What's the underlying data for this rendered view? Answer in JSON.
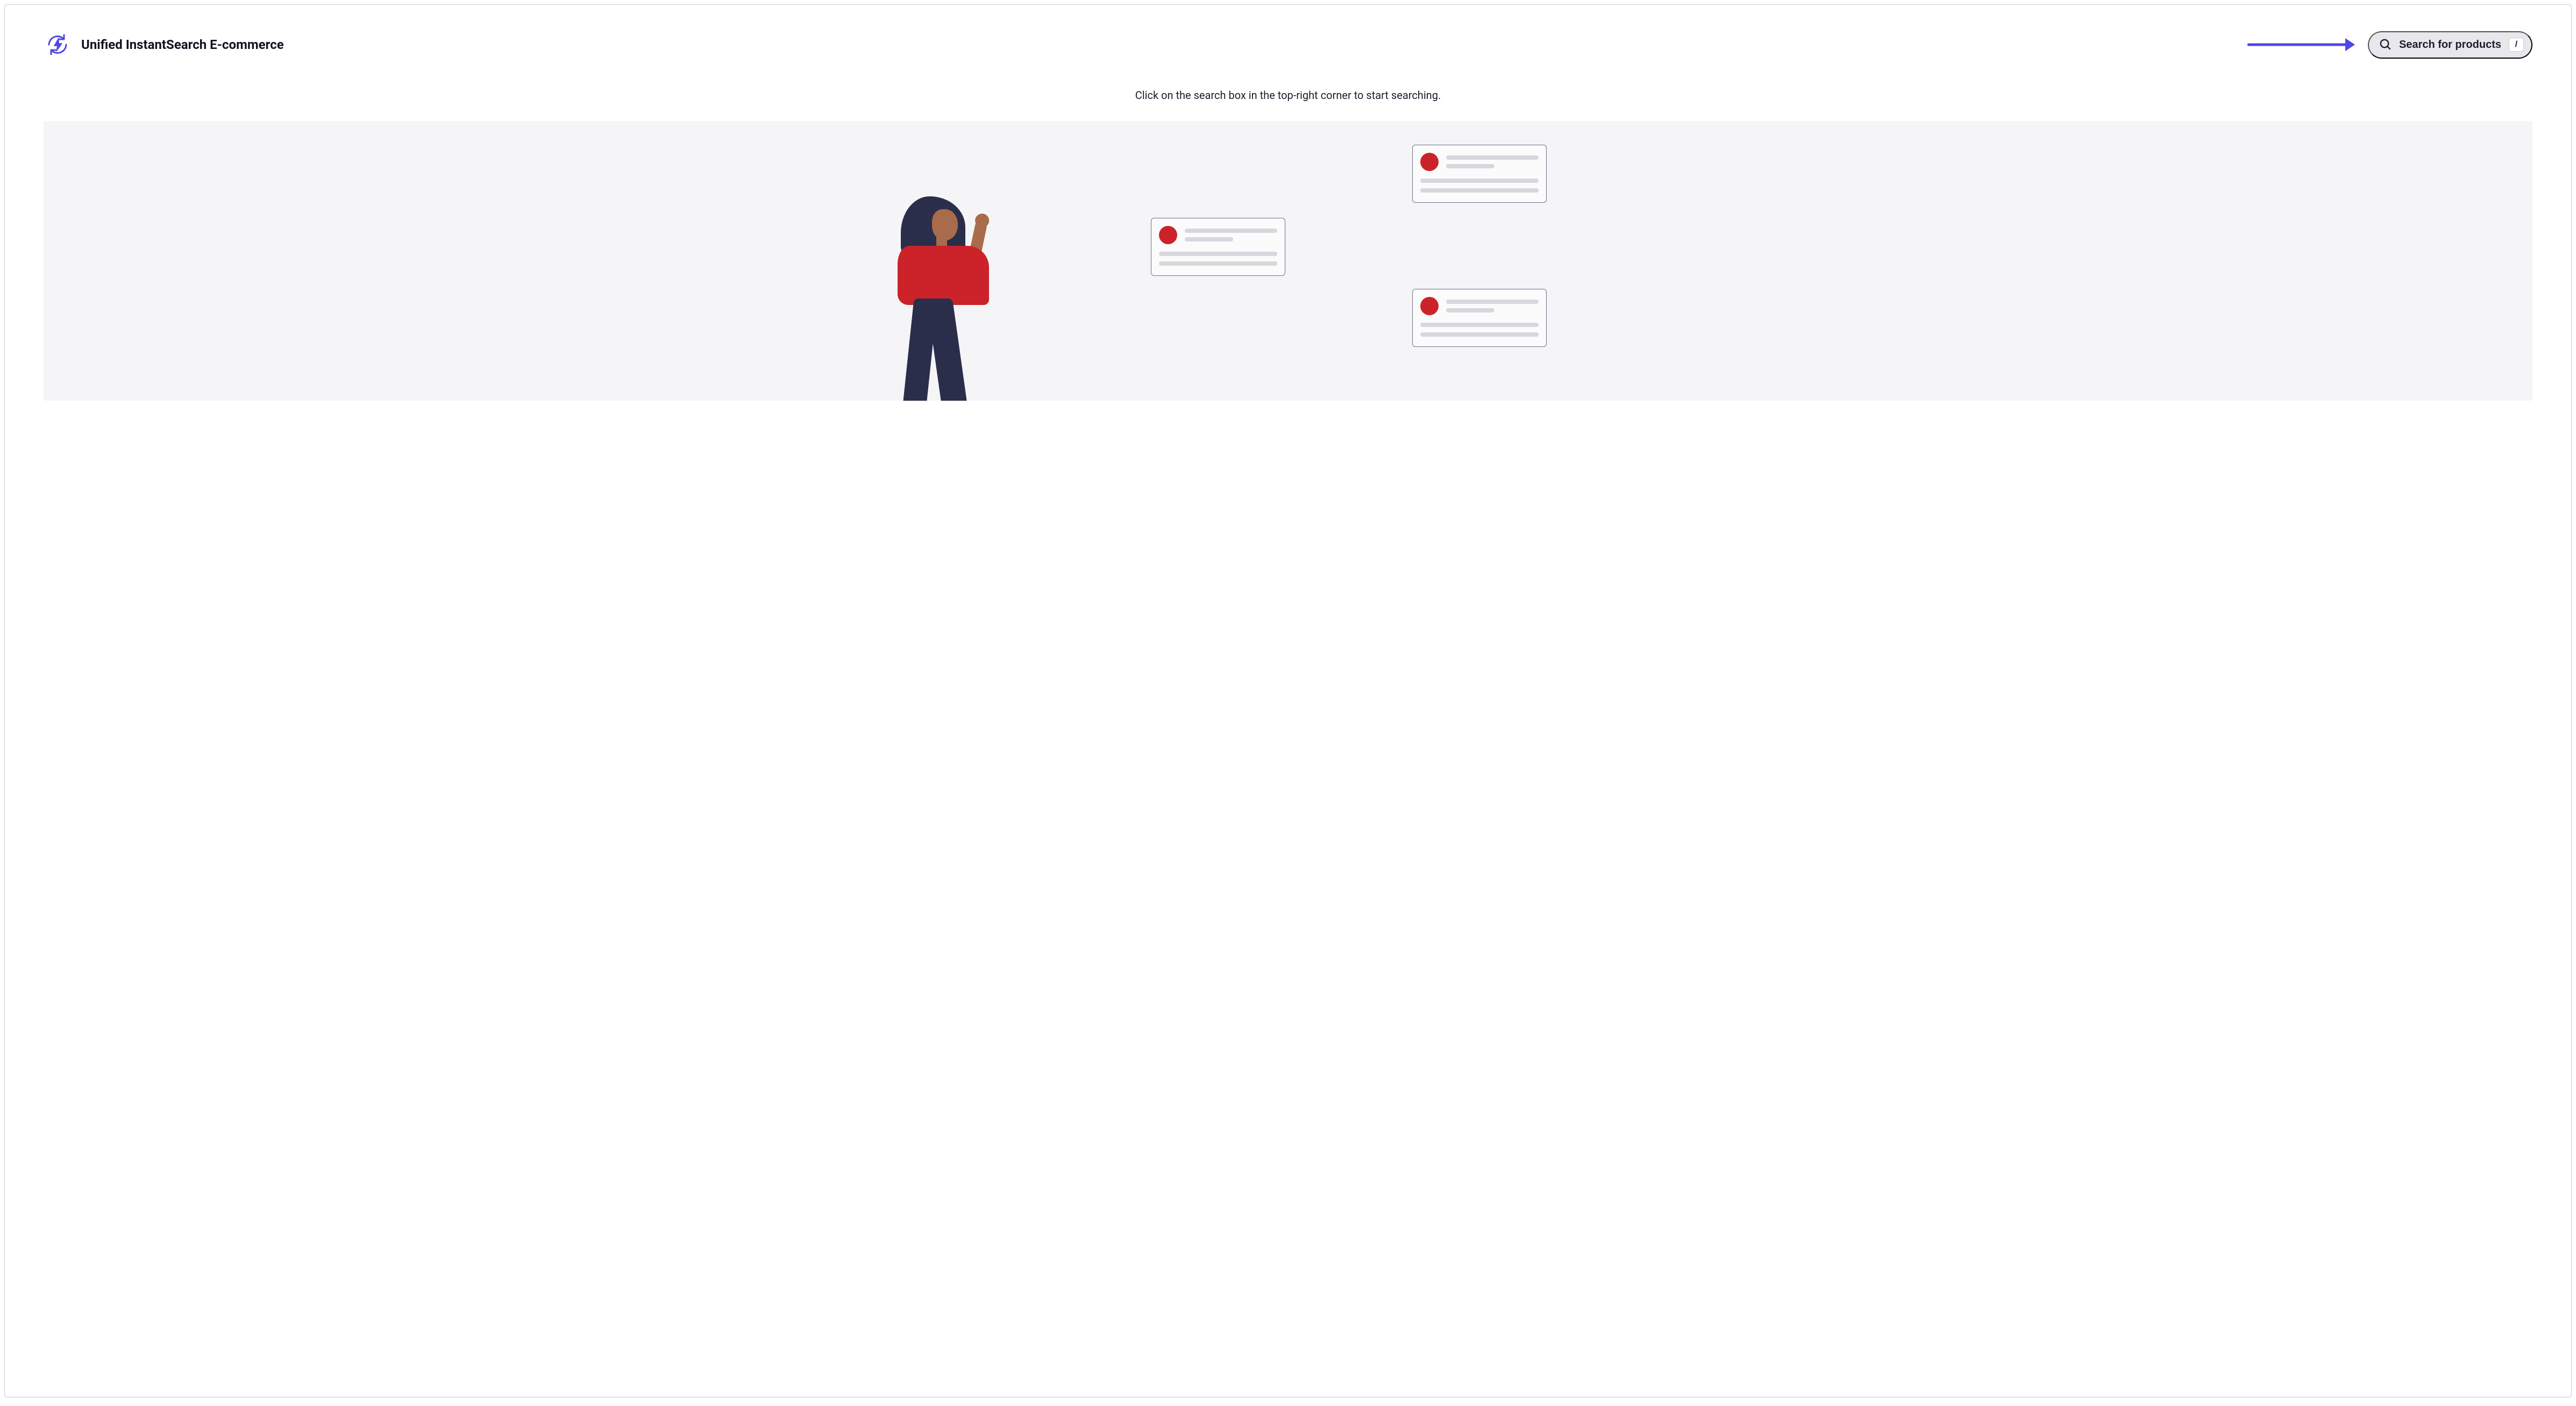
{
  "header": {
    "title": "Unified InstantSearch E-commerce"
  },
  "search": {
    "placeholder": "Search for products",
    "shortcut": "/"
  },
  "instruction": "Click on the search box in the top-right corner to start searching."
}
